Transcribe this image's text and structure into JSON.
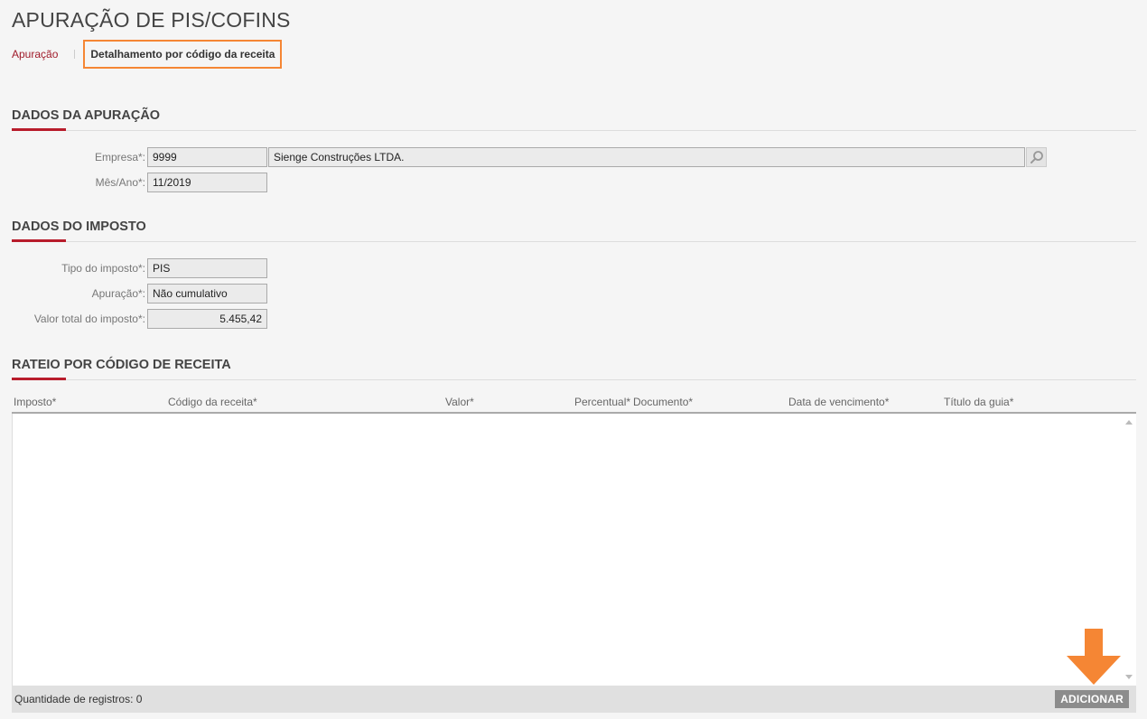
{
  "page": {
    "title": "APURAÇÃO DE PIS/COFINS"
  },
  "tabs": [
    {
      "label": "Apuração",
      "active": false
    },
    {
      "label": "Detalhamento por código da receita",
      "active": true
    }
  ],
  "dados_apuracao": {
    "title": "DADOS DA APURAÇÃO",
    "empresa": {
      "label": "Empresa*:",
      "code": "9999",
      "name": "Sienge Construções LTDA.",
      "lookup_icon": "search-icon"
    },
    "mes_ano": {
      "label": "Mês/Ano*:",
      "value": "11/2019"
    }
  },
  "dados_imposto": {
    "title": "DADOS DO IMPOSTO",
    "tipo": {
      "label": "Tipo do imposto*:",
      "value": "PIS"
    },
    "apuracao": {
      "label": "Apuração*:",
      "value": "Não cumulativo"
    },
    "valor_total": {
      "label": "Valor total do imposto*:",
      "value": "5.455,42"
    }
  },
  "rateio": {
    "title": "RATEIO POR CÓDIGO DE RECEITA",
    "columns": [
      "Imposto*",
      "Código da receita*",
      "Valor*",
      "Percentual*",
      "Documento*",
      "Data de vencimento*",
      "Título da guia*"
    ],
    "rows": [],
    "footer_label": "Quantidade de registros: 0",
    "add_label": "ADICIONAR"
  },
  "colors": {
    "accent": "#b81c2b",
    "highlight": "#f58634",
    "link": "#a01c2b"
  }
}
